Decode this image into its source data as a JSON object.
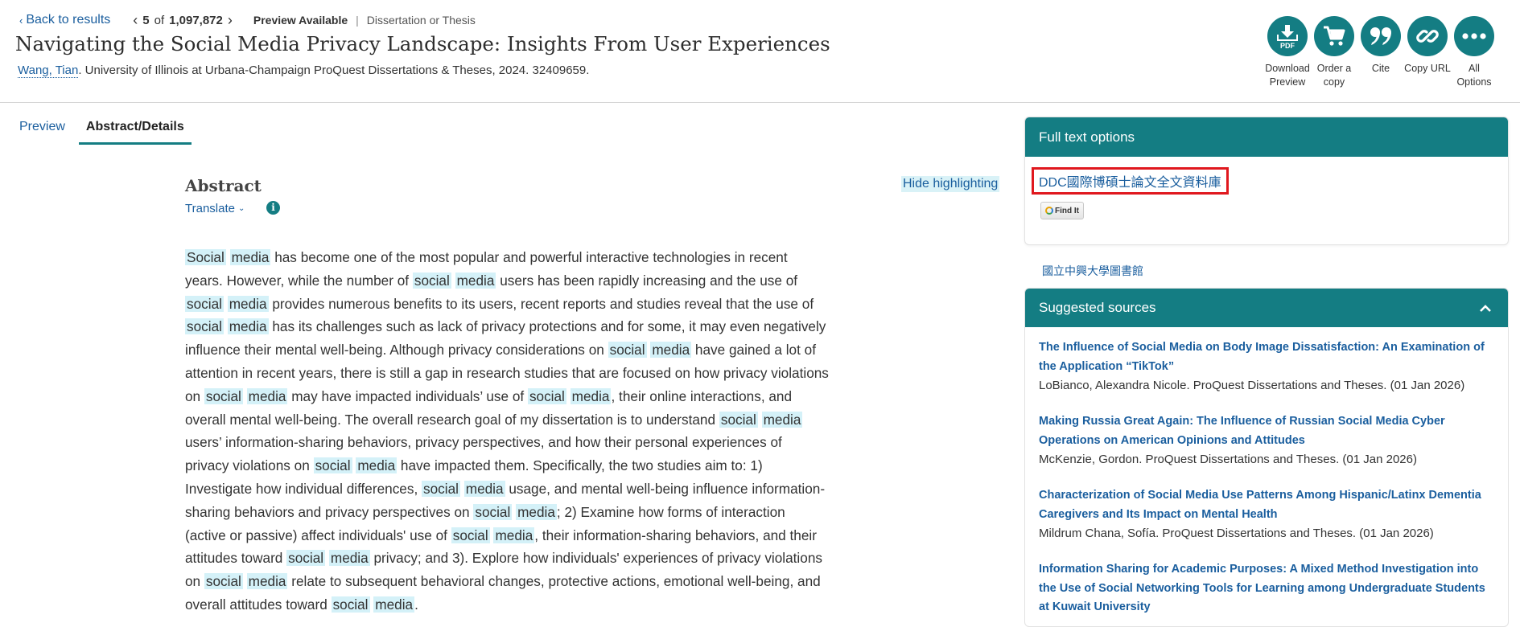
{
  "nav": {
    "back_label": "Back to results",
    "position": "5",
    "of_label": "of",
    "total": "1,097,872",
    "availability": "Preview Available",
    "doc_type": "Dissertation or Thesis"
  },
  "document": {
    "title": "Navigating the Social Media Privacy Landscape: Insights From User Experiences",
    "author": "Wang, Tian",
    "citation": "University of Illinois at Urbana-Champaign ProQuest Dissertations & Theses,  2024. 32409659."
  },
  "actions": [
    {
      "label_line1": "Download",
      "label_line2": "Preview",
      "icon": "download-pdf-icon"
    },
    {
      "label_line1": "Order a",
      "label_line2": "copy",
      "icon": "cart-icon"
    },
    {
      "label_line1": "Cite",
      "label_line2": "",
      "icon": "quote-icon"
    },
    {
      "label_line1": "Copy URL",
      "label_line2": "",
      "icon": "link-icon"
    },
    {
      "label_line1": "All",
      "label_line2": "Options",
      "icon": "more-icon"
    }
  ],
  "tabs": [
    {
      "label": "Preview",
      "active": false
    },
    {
      "label": "Abstract/Details",
      "active": true
    }
  ],
  "abstract": {
    "heading": "Abstract",
    "translate_label": "Translate",
    "hide_highlighting_label": "Hide highlighting",
    "highlight_terms": [
      "Social",
      "media",
      "social"
    ],
    "text": "Social media has become one of the most popular and powerful interactive technologies in recent years. However, while the number of social media users has been rapidly increasing and the use of social media provides numerous benefits to its users, recent reports and studies reveal that the use of social media has its challenges such as lack of privacy protections and for some, it may even negatively influence their mental well-being. Although privacy considerations on social media have gained a lot of attention in recent years, there is still a gap in research studies that are focused on how privacy violations on social media may have impacted individuals’ use of social media, their online interactions, and overall mental well-being. The overall research goal of my dissertation is to understand social media users’ information-sharing behaviors, privacy perspectives, and how their personal experiences of privacy violations on social media have impacted them. Specifically, the two studies aim to: 1) Investigate how individual differences, social media usage, and mental well-being influence information-sharing behaviors and privacy perspectives on social media; 2) Examine how forms of interaction (active or passive) affect individuals' use of social media, their information-sharing behaviors, and their attitudes toward social media privacy; and 3). Explore how individuals' experiences of privacy violations on social media relate to subsequent behavioral changes, protective actions, emotional well-being, and overall attitudes toward social media."
  },
  "full_text": {
    "heading": "Full text options",
    "ddc_link": "DDC國際博碩士論文全文資料庫",
    "findit_label": "Find It"
  },
  "library_label": "國立中興大學圖書館",
  "suggested": {
    "heading": "Suggested sources",
    "items": [
      {
        "title": "The Influence of Social Media on Body Image Dissatisfaction: An Examination of the Application “TikTok”",
        "meta": "LoBianco, Alexandra Nicole.  ProQuest Dissertations and Theses. (01 Jan 2026)"
      },
      {
        "title": "Making Russia Great Again: The Influence of Russian Social Media Cyber Operations on American Opinions and Attitudes",
        "meta": "McKenzie, Gordon.  ProQuest Dissertations and Theses. (01 Jan 2026)"
      },
      {
        "title": "Characterization of Social Media Use Patterns Among Hispanic/Latinx Dementia Caregivers and Its Impact on Mental Health",
        "meta": "Mildrum Chana, Sofía.  ProQuest Dissertations and Theses. (01 Jan 2026)"
      },
      {
        "title": "Information Sharing for Academic Purposes: A Mixed Method Investigation into the Use of Social Networking Tools for Learning among Undergraduate Students at Kuwait University",
        "meta": ""
      }
    ]
  },
  "colors": {
    "accent": "#147d83",
    "link": "#1a5e9e",
    "highlight": "#d4f1f8",
    "outline": "#e0181e"
  }
}
